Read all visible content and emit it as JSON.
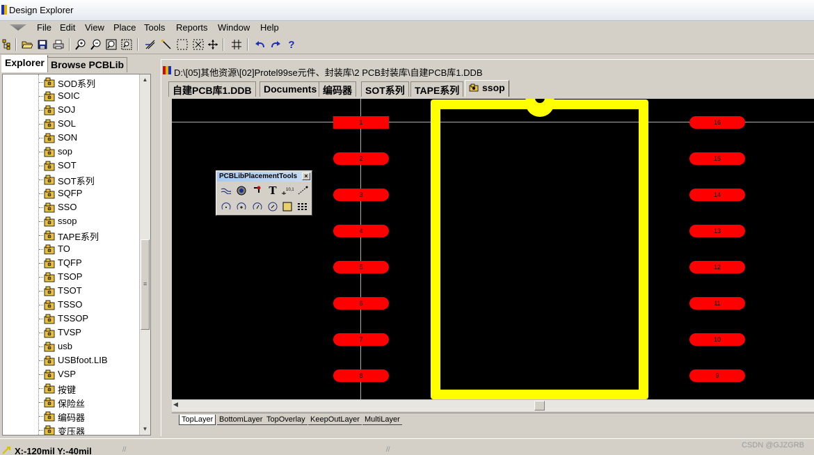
{
  "window": {
    "title": "Design Explorer"
  },
  "menu": [
    "File",
    "Edit",
    "View",
    "Place",
    "Tools",
    "Reports",
    "Window",
    "Help"
  ],
  "toolbar": {
    "icons": [
      "tree-icon",
      "open-icon",
      "save-icon",
      "print-icon",
      "zoom-in-icon",
      "zoom-out-icon",
      "zoom-fit-icon",
      "zoom-area-icon",
      "cut-icon",
      "wire-icon",
      "select-icon",
      "deselect-icon",
      "move-icon",
      "grid-icon",
      "undo-icon",
      "redo-icon",
      "help-icon"
    ]
  },
  "left_panel": {
    "tabs": [
      "Explorer",
      "Browse PCBLib"
    ],
    "items": [
      "SOD系列",
      "SOIC",
      "SOJ",
      "SOL",
      "SON",
      "sop",
      "SOT",
      "SOT系列",
      "SQFP",
      "SSO",
      "ssop",
      "TAPE系列",
      "TO",
      "TQFP",
      "TSOP",
      "TSOT",
      "TSSO",
      "TSSOP",
      "TVSP",
      "usb",
      "USBfoot.LIB",
      "VSP",
      "按键",
      "保险丝",
      "编码器",
      "变压器"
    ]
  },
  "document": {
    "path": "D:\\[05]其他资源\\[02]Protel99se元件、封装库\\2 PCB封装库\\自建PCB库1.DDB",
    "tabs": [
      "自建PCB库1.DDB",
      "Documents",
      "编码器",
      "SOT系列",
      "TAPE系列",
      "ssop"
    ],
    "active_tab": "ssop",
    "layer_tabs": [
      "TopLayer",
      "BottomLayer",
      "TopOverlay",
      "KeepOutLayer",
      "MultiLayer"
    ]
  },
  "footprint": {
    "left_pads": [
      "1",
      "2",
      "3",
      "4",
      "5",
      "6",
      "7",
      "8"
    ],
    "right_pads": [
      "16",
      "15",
      "14",
      "13",
      "12",
      "11",
      "10",
      "9"
    ],
    "pad_color": "#ff0000",
    "outline_color": "#ffff00",
    "background_color": "#000000"
  },
  "placement_tools": {
    "title": "PCBLibPlacementTools",
    "close_label": "×",
    "row1": [
      "line-icon",
      "pad-icon",
      "via-icon",
      "T",
      "coordinate-icon",
      "dimension-icon"
    ],
    "row2": [
      "arc-center-icon",
      "arc-edge-icon",
      "arc-any-icon",
      "circle-icon",
      "fill-icon",
      "array-icon"
    ]
  },
  "status": {
    "coords": "X:-120mil Y:-40mil",
    "watermark": "CSDN @GJZGRB"
  }
}
